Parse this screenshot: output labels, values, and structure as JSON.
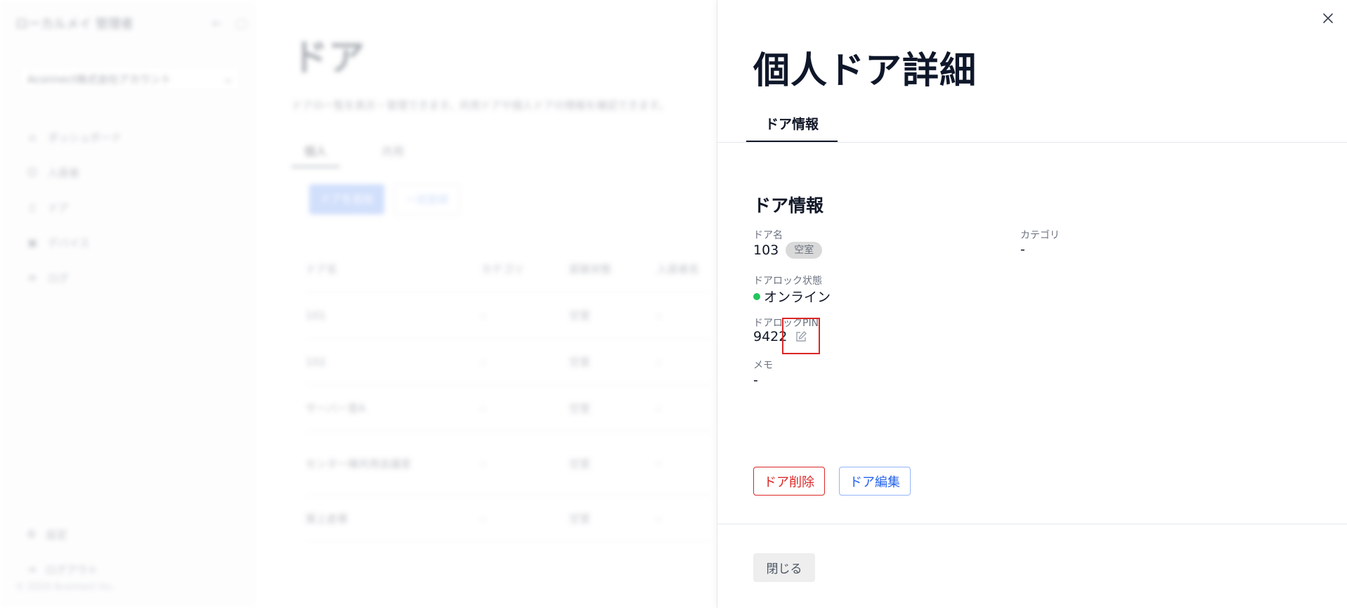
{
  "background": {
    "app_title": "ローカルメイ 管理者",
    "workspace": "Aconnect株式会社アカウント",
    "nav": [
      "ダッシュボード",
      "入居者",
      "ドア",
      "デバイス",
      "ログ"
    ],
    "nav_bottom": [
      "設定",
      "ログアウト"
    ],
    "footer": "© 2024 Aconnect Inc.",
    "page_title": "ドア",
    "page_desc": "ドアの一覧を表示・管理できます。共用ドアや個人ドアの情報を確認できます。",
    "tabs": [
      "個人",
      "共用"
    ],
    "btn_add": "ドアを追加",
    "btn_bulk": "一括登録",
    "table_headers": [
      "ドア名",
      "カテゴリ",
      "部屋状態",
      "入居者名"
    ],
    "table_rows": [
      [
        "101",
        "-",
        "空室",
        "-"
      ],
      [
        "102",
        "-",
        "空室",
        "-"
      ],
      [
        "サーバー室A",
        "-",
        "空室",
        "-"
      ],
      [
        "センター棟共用会議室",
        "-",
        "空室",
        "-"
      ],
      [
        "屋上倉庫",
        "-",
        "空室",
        "-"
      ]
    ]
  },
  "drawer": {
    "title": "個人ドア詳細",
    "tab_label": "ドア情報",
    "section_title": "ドア情報",
    "fields": {
      "door_name_label": "ドア名",
      "door_name_value": "103",
      "door_status_badge": "空室",
      "category_label": "カテゴリ",
      "category_value": "-",
      "lock_state_label": "ドアロック状態",
      "lock_state_value": "オンライン",
      "pin_label": "ドアロックPIN",
      "pin_value": "9422",
      "memo_label": "メモ",
      "memo_value": "-"
    },
    "buttons": {
      "delete": "ドア削除",
      "edit": "ドア編集",
      "close": "閉じる"
    },
    "colors": {
      "online_dot": "#22c55e",
      "delete": "#dc2626",
      "edit": "#2563eb",
      "highlight": "#dc2626"
    },
    "icons": {
      "close": "close-icon",
      "edit_pin": "pencil-edit-icon"
    }
  }
}
